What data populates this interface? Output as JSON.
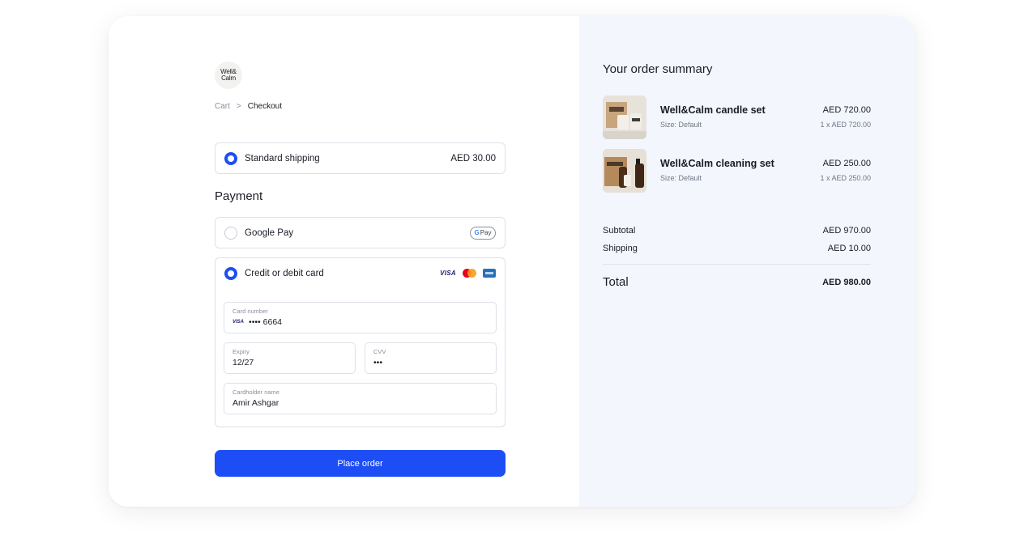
{
  "brand": {
    "logo_line1": "Well&",
    "logo_line2": "Calm"
  },
  "breadcrumb": {
    "items": [
      "Cart",
      "Checkout"
    ],
    "separator": ">"
  },
  "shipping": {
    "label": "Standard shipping",
    "price": "AED 30.00",
    "selected": true
  },
  "payment": {
    "title": "Payment",
    "options": [
      {
        "label": "Google Pay",
        "badge": "Pay",
        "selected": false
      },
      {
        "label": "Credit or debit card",
        "brands": [
          "VISA",
          "mastercard",
          "amex"
        ],
        "selected": true
      }
    ],
    "card_form": {
      "card_number_label": "Card number",
      "card_number_value": "•••• 6664",
      "card_brand": "VISA",
      "expiry_label": "Expiry",
      "expiry_value": "12/27",
      "cvv_label": "CVV",
      "cvv_value": "•••",
      "cardholder_label": "Cardholder name",
      "cardholder_value": "Amir Ashgar"
    }
  },
  "place_order_label": "Place order",
  "summary": {
    "title": "Your order summary",
    "items": [
      {
        "name": "Well&Calm candle set",
        "size": "Size: Default",
        "price": "AED 720.00",
        "qty": "1 x AED 720.00"
      },
      {
        "name": "Well&Calm cleaning set",
        "size": "Size: Default",
        "price": "AED 250.00",
        "qty": "1 x AED 250.00"
      }
    ],
    "subtotal_label": "Subtotal",
    "subtotal_value": "AED 970.00",
    "shipping_label": "Shipping",
    "shipping_value": "AED 10.00",
    "total_label": "Total",
    "total_value": "AED 980.00"
  },
  "colors": {
    "accent": "#1d4ef5",
    "summary_bg": "#f3f6fd",
    "border": "#dde1e8"
  }
}
